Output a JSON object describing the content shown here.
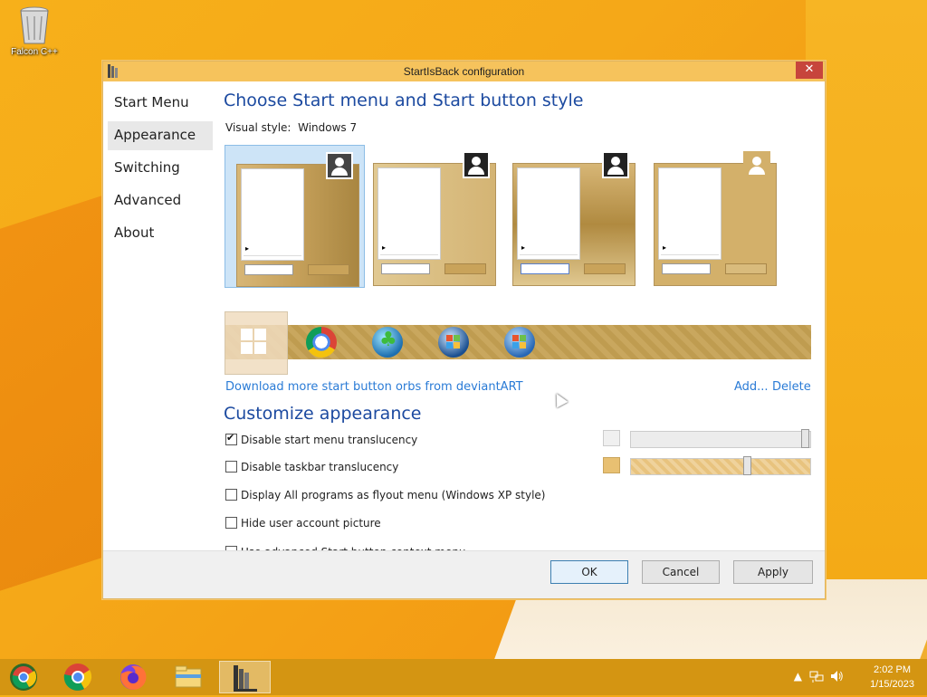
{
  "desktop": {
    "icons": [
      {
        "label": "Falcon C++",
        "icon": "recycle-bin-icon"
      }
    ]
  },
  "window": {
    "title": "StartIsBack configuration",
    "close_label": "✕",
    "sidebar": [
      {
        "label": "Start Menu"
      },
      {
        "label": "Appearance",
        "active": true
      },
      {
        "label": "Switching"
      },
      {
        "label": "Advanced"
      },
      {
        "label": "About"
      }
    ],
    "heading_style": "Choose Start menu and Start button style",
    "visual_style_label": "Visual style:",
    "visual_style_value": "Windows 7",
    "styles": [
      {
        "name": "style-1",
        "selected": true
      },
      {
        "name": "style-2",
        "selected": false
      },
      {
        "name": "style-3",
        "selected": false
      },
      {
        "name": "style-4",
        "selected": false
      }
    ],
    "orbs": [
      {
        "icon": "windows8-orb-icon",
        "selected": true
      },
      {
        "icon": "chrome-orb-icon"
      },
      {
        "icon": "clover-orb-icon"
      },
      {
        "icon": "vista-orb-icon"
      },
      {
        "icon": "windows7-orb-icon"
      }
    ],
    "download_link": "Download more start button orbs from deviantART",
    "add_link": "Add...",
    "delete_link": "Delete",
    "heading_customize": "Customize appearance",
    "options": [
      {
        "label": "Disable start menu translucency",
        "checked": true
      },
      {
        "label": "Disable taskbar translucency",
        "checked": false
      },
      {
        "label": "Display All programs as flyout menu (Windows XP style)",
        "checked": false
      },
      {
        "label": "Hide user account picture",
        "checked": false
      },
      {
        "label": "Use advanced Start button context menu",
        "checked": false
      }
    ],
    "sliders": [
      {
        "name": "start-menu-opacity",
        "swatch_color": "#f0f0f0",
        "value": 1.0
      },
      {
        "name": "taskbar-opacity",
        "swatch_color": "#e8c072",
        "value": 0.6
      }
    ],
    "buttons": {
      "ok": "OK",
      "cancel": "Cancel",
      "apply": "Apply"
    }
  },
  "taskbar": {
    "apps": [
      {
        "icon": "chrome-start-orb-icon"
      },
      {
        "icon": "chrome-icon"
      },
      {
        "icon": "firefox-icon"
      },
      {
        "icon": "file-explorer-icon"
      },
      {
        "icon": "startisback-config-icon",
        "active": true
      }
    ],
    "time": "2:02 PM",
    "date": "1/15/2023"
  },
  "colors": {
    "accent": "#1c4aa0",
    "link": "#2a7bd6",
    "titlebar": "#f6c35c",
    "taskbar": "#d49512"
  }
}
